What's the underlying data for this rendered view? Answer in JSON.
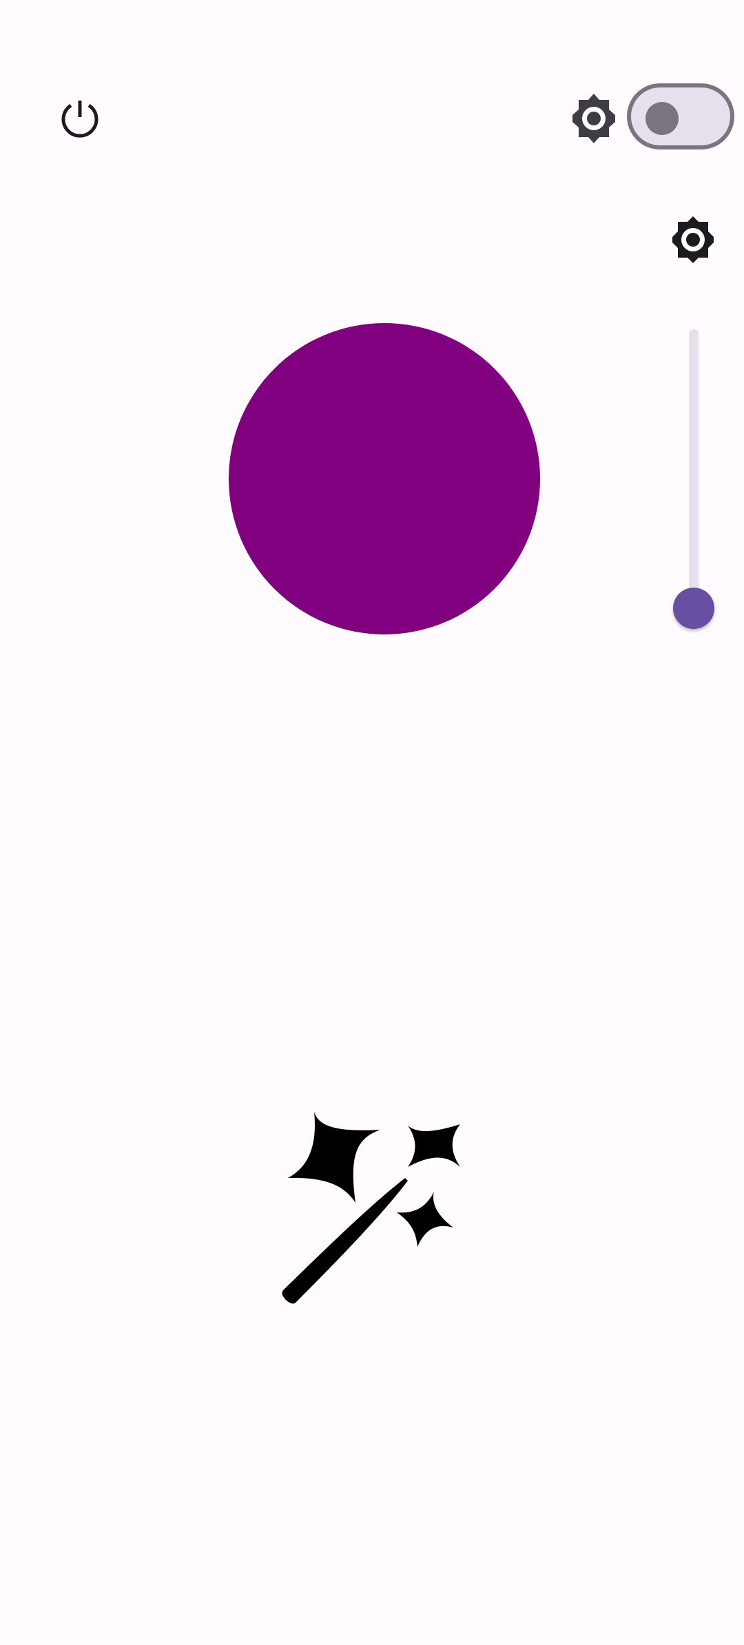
{
  "controls": {
    "power_icon": "power-icon",
    "auto_brightness_icon": "brightness-auto-icon",
    "switch_state": "off",
    "brightness_icon": "brightness-icon",
    "brightness_level": 0.07,
    "night_icon": "moon-icon"
  },
  "light": {
    "color": "#800080"
  },
  "effects": {
    "icon": "magic-wand-icon"
  },
  "colors": {
    "background": "#FFFBFE",
    "accent": "#6750A4",
    "outline": "#79747E",
    "track": "#E7E0EC"
  }
}
